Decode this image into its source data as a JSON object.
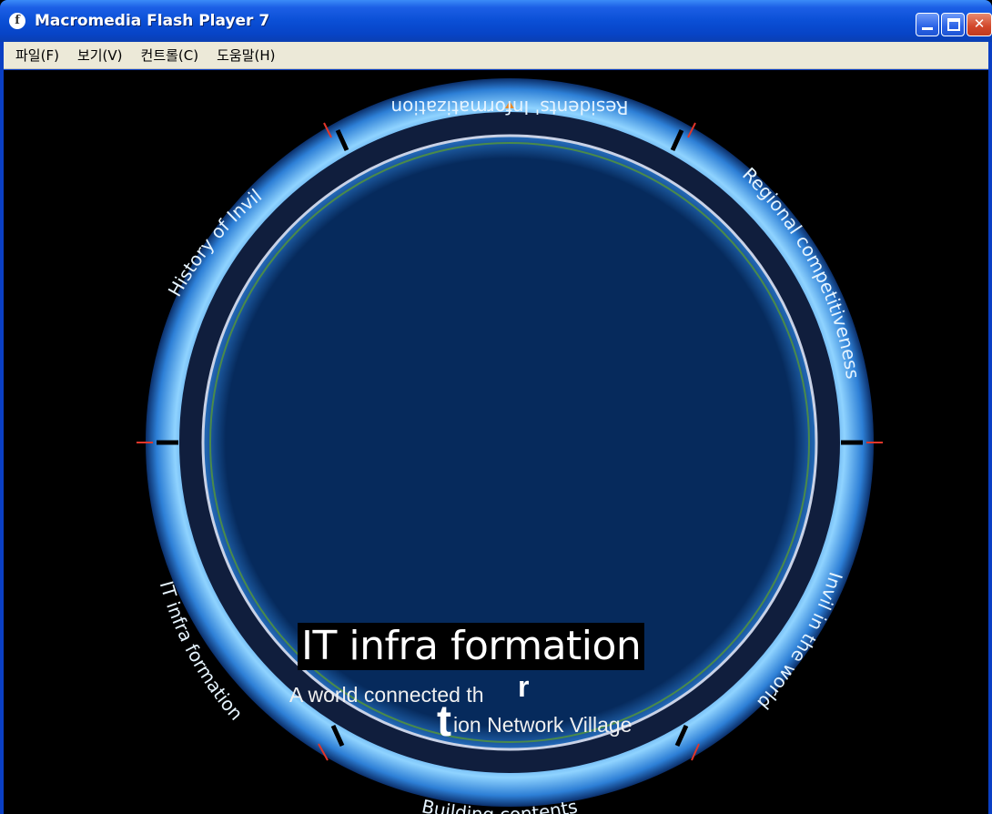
{
  "window": {
    "title": "Macromedia Flash Player 7",
    "app_icon_glyph": "f"
  },
  "menubar": {
    "items": [
      "파일(F)",
      "보기(V)",
      "컨트롤(C)",
      "도움말(H)"
    ]
  },
  "ring_labels": {
    "top": "Residents' Informatization",
    "upper_right": "Regional competitiveness",
    "lower_right": "Invil in the world",
    "bottom": "Building contents",
    "lower_left": "IT infra formation",
    "upper_left": "History of Invil"
  },
  "caption": {
    "headline": "IT infra formation",
    "line1": "A world connected th",
    "big_r": "r",
    "big_t": "t",
    "line2": "ion Network Village"
  },
  "colors": {
    "ring_blue": "#2d7fd6",
    "ring_light": "#8fd3ff",
    "ring_dark": "#0b2f6a",
    "inner_rim": "#1a2f5a",
    "accent_tick": "#e2362a"
  },
  "icons": {
    "app": "flash-player-icon",
    "minimize": "minimize-icon",
    "maximize": "maximize-icon",
    "close": "close-icon"
  }
}
